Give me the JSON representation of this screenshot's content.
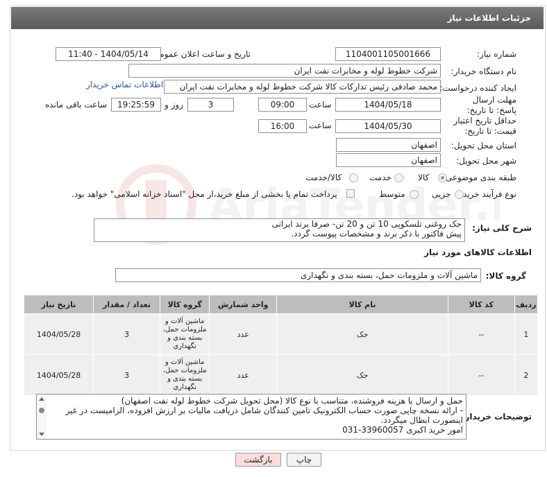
{
  "header": {
    "title": "جزئیات اطلاعات نیاز"
  },
  "fields": {
    "need_number_label": "شماره نیاز:",
    "need_number": "1104001105001666",
    "announce_label": "تاریخ و ساعت اعلان عمومی:",
    "announce_value": "1404/05/14 - 11:40",
    "buyer_label": "نام دستگاه خریدار:",
    "buyer_value": "شرکت خطوط لوله و مخابرات نفت ایران",
    "creator_label": "ایجاد کننده درخواست:",
    "creator_value": "محمد صادقی رئیس تدارکات کالا  شرکت خطوط لوله و مخابرات نفت ایران",
    "contact_link": "اطلاعات تماس خریدار",
    "deadline_label": "مهلت ارسال پاسخ: تا تاریخ:",
    "deadline_date": "1404/05/18",
    "time_word": "ساعت",
    "deadline_time": "09:00",
    "days_value": "3",
    "days_word": "روز و",
    "remaining_time": "19:25:59",
    "remaining_label": "ساعت باقی مانده",
    "price_validity_label": "حداقل تاریخ اعتبار قیمت: تا تاریخ:",
    "price_date": "1404/05/30",
    "price_time": "16:00",
    "province_label": "استان محل تحویل:",
    "province_value": "اصفهان",
    "city_label": "شهر محل تحویل:",
    "city_value": "اصفهان",
    "category_label": "طبقه بندی موضوعی:",
    "category_options": [
      "کالا",
      "خدمت",
      "کالا/خدمت"
    ],
    "process_label": "نوع فرآیند خرید :",
    "process_options": [
      "جزیی",
      "متوسط"
    ],
    "payment_note": "پرداخت تمام یا بخشی از مبلغ خرید،از محل \"اسناد خزانه اسلامی\" خواهد بود.",
    "summary_label": "شرح کلی نیاز:",
    "summary_line1": "جک روغنی تلسکوپی 10 تن و 20 تن- صرفا برند ایرانی",
    "summary_line2": "پیش فاکتور با ذکر برند و مشخصات پیوست گردد."
  },
  "goods_section": {
    "title": "اطلاعات کالاهای مورد نیاز",
    "group_label": "گروه کالا:",
    "group_value": "ماشین آلات و ملزومات حمل، بسته بندی و نگهداری"
  },
  "table": {
    "headers": [
      "ردیف",
      "کد کالا",
      "نام کالا",
      "واحد شمارش",
      "گروه کالا",
      "تعداد / مقدار",
      "تاریخ نیاز"
    ],
    "rows": [
      [
        "1",
        "--",
        "جک",
        "عدد",
        "ماشین آلات و ملزومات حمل، بسته بندی و نگهداری",
        "3",
        "1404/05/28"
      ],
      [
        "2",
        "--",
        "جک",
        "عدد",
        "ماشین آلات و ملزومات حمل، بسته بندی و نگهداری",
        "3",
        "1404/05/28"
      ]
    ]
  },
  "buyer_notes": {
    "label": "توضیحات خریدار:",
    "line1": "حمل و ارسال  با هزینه فروشنده، متناسب با نوع کالا (محل تحویل شرکت خطوط لوله نفت اصفهان)",
    "line2": "- ارائه نسخه چاپی صورت حساب الکترونیک تامین کنندگان شامل دریافت مالیات بر ارزش افزوده، الزامیست در غیر اینصورت ابطال میگردد.",
    "line3": "امور خرید اکبری 33960057-031"
  },
  "buttons": {
    "print": "چاپ",
    "back": "بازگشت"
  },
  "watermark": {
    "text": "AriaTender.neT"
  },
  "colors": {
    "header_bg": "#6b6b6b",
    "table_header": "#bdbdbd",
    "row_bg": "#efefef",
    "link": "#2255aa",
    "back_button": "#f9dede"
  }
}
